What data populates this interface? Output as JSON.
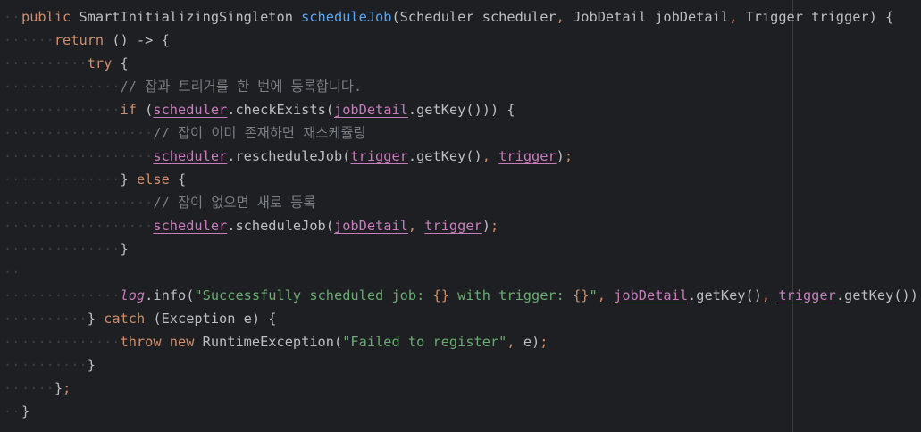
{
  "editor": {
    "lines": [
      [
        [
          "kw",
          "public "
        ],
        [
          "code",
          "SmartInitializingSingleton "
        ],
        [
          "fn",
          "scheduleJob"
        ],
        [
          "code",
          "(Scheduler scheduler"
        ],
        [
          "kw",
          ", "
        ],
        [
          "code",
          "JobDetail jobDetail"
        ],
        [
          "kw",
          ", "
        ],
        [
          "code",
          "Trigger trigger) {"
        ]
      ],
      [
        [
          "ws",
          "····"
        ],
        [
          "kw",
          "return "
        ],
        [
          "code",
          "() -> {"
        ]
      ],
      [
        [
          "ws",
          "········"
        ],
        [
          "kw",
          "try "
        ],
        [
          "code",
          "{"
        ]
      ],
      [
        [
          "ws",
          "············"
        ],
        [
          "cm",
          "// 잡과 트리거를 한 번에 등록합니다."
        ]
      ],
      [
        [
          "ws",
          "············"
        ],
        [
          "kw",
          "if "
        ],
        [
          "code",
          "("
        ],
        [
          "field",
          "scheduler"
        ],
        [
          "code",
          ".checkExists("
        ],
        [
          "field",
          "jobDetail"
        ],
        [
          "code",
          ".getKey())) {"
        ]
      ],
      [
        [
          "ws",
          "················"
        ],
        [
          "cm",
          "// 잡이 이미 존재하면 재스케쥴링"
        ]
      ],
      [
        [
          "ws",
          "················"
        ],
        [
          "field",
          "scheduler"
        ],
        [
          "code",
          ".rescheduleJob("
        ],
        [
          "field",
          "trigger"
        ],
        [
          "code",
          ".getKey()"
        ],
        [
          "kw",
          ", "
        ],
        [
          "field",
          "trigger"
        ],
        [
          "code",
          ")"
        ],
        [
          "kw",
          ";"
        ]
      ],
      [
        [
          "ws",
          "············"
        ],
        [
          "code",
          "} "
        ],
        [
          "kw",
          "else "
        ],
        [
          "code",
          "{"
        ]
      ],
      [
        [
          "ws",
          "················"
        ],
        [
          "cm",
          "// 잡이 없으면 새로 등록"
        ]
      ],
      [
        [
          "ws",
          "················"
        ],
        [
          "field",
          "scheduler"
        ],
        [
          "code",
          ".scheduleJob("
        ],
        [
          "field",
          "jobDetail"
        ],
        [
          "kw",
          ", "
        ],
        [
          "field",
          "trigger"
        ],
        [
          "code",
          ")"
        ],
        [
          "kw",
          ";"
        ]
      ],
      [
        [
          "ws",
          "············"
        ],
        [
          "code",
          "}"
        ]
      ],
      [
        [
          "ws",
          ""
        ]
      ],
      [
        [
          "ws",
          "············"
        ],
        [
          "logf",
          "log"
        ],
        [
          "code",
          ".info("
        ],
        [
          "str",
          "\"Successfully scheduled job: "
        ],
        [
          "fmt",
          "{}"
        ],
        [
          "str",
          " with trigger: "
        ],
        [
          "fmt",
          "{}"
        ],
        [
          "str",
          "\""
        ],
        [
          "kw",
          ", "
        ],
        [
          "field",
          "jobDetail"
        ],
        [
          "code",
          ".getKey()"
        ],
        [
          "kw",
          ", "
        ],
        [
          "field",
          "trigger"
        ],
        [
          "code",
          ".getKey())"
        ],
        [
          "kw",
          ";"
        ]
      ],
      [
        [
          "ws",
          "········"
        ],
        [
          "code",
          "} "
        ],
        [
          "kw",
          "catch "
        ],
        [
          "code",
          "(Exception e) {"
        ]
      ],
      [
        [
          "ws",
          "············"
        ],
        [
          "kw",
          "throw new "
        ],
        [
          "code",
          "RuntimeException("
        ],
        [
          "str",
          "\"Failed to register\""
        ],
        [
          "kw",
          ", "
        ],
        [
          "code",
          "e)"
        ],
        [
          "kw",
          ";"
        ]
      ],
      [
        [
          "ws",
          "········"
        ],
        [
          "code",
          "}"
        ]
      ],
      [
        [
          "ws",
          "····"
        ],
        [
          "code",
          "}"
        ],
        [
          "kw",
          ";"
        ]
      ],
      [
        [
          "code",
          "}"
        ]
      ]
    ]
  },
  "colors": {
    "background": "#1e1f22",
    "keyword": "#cf8e6d",
    "method": "#56a8f5",
    "string": "#6aab73",
    "comment": "#7a7e85",
    "field": "#c77dbb",
    "text": "#bcbec4"
  }
}
